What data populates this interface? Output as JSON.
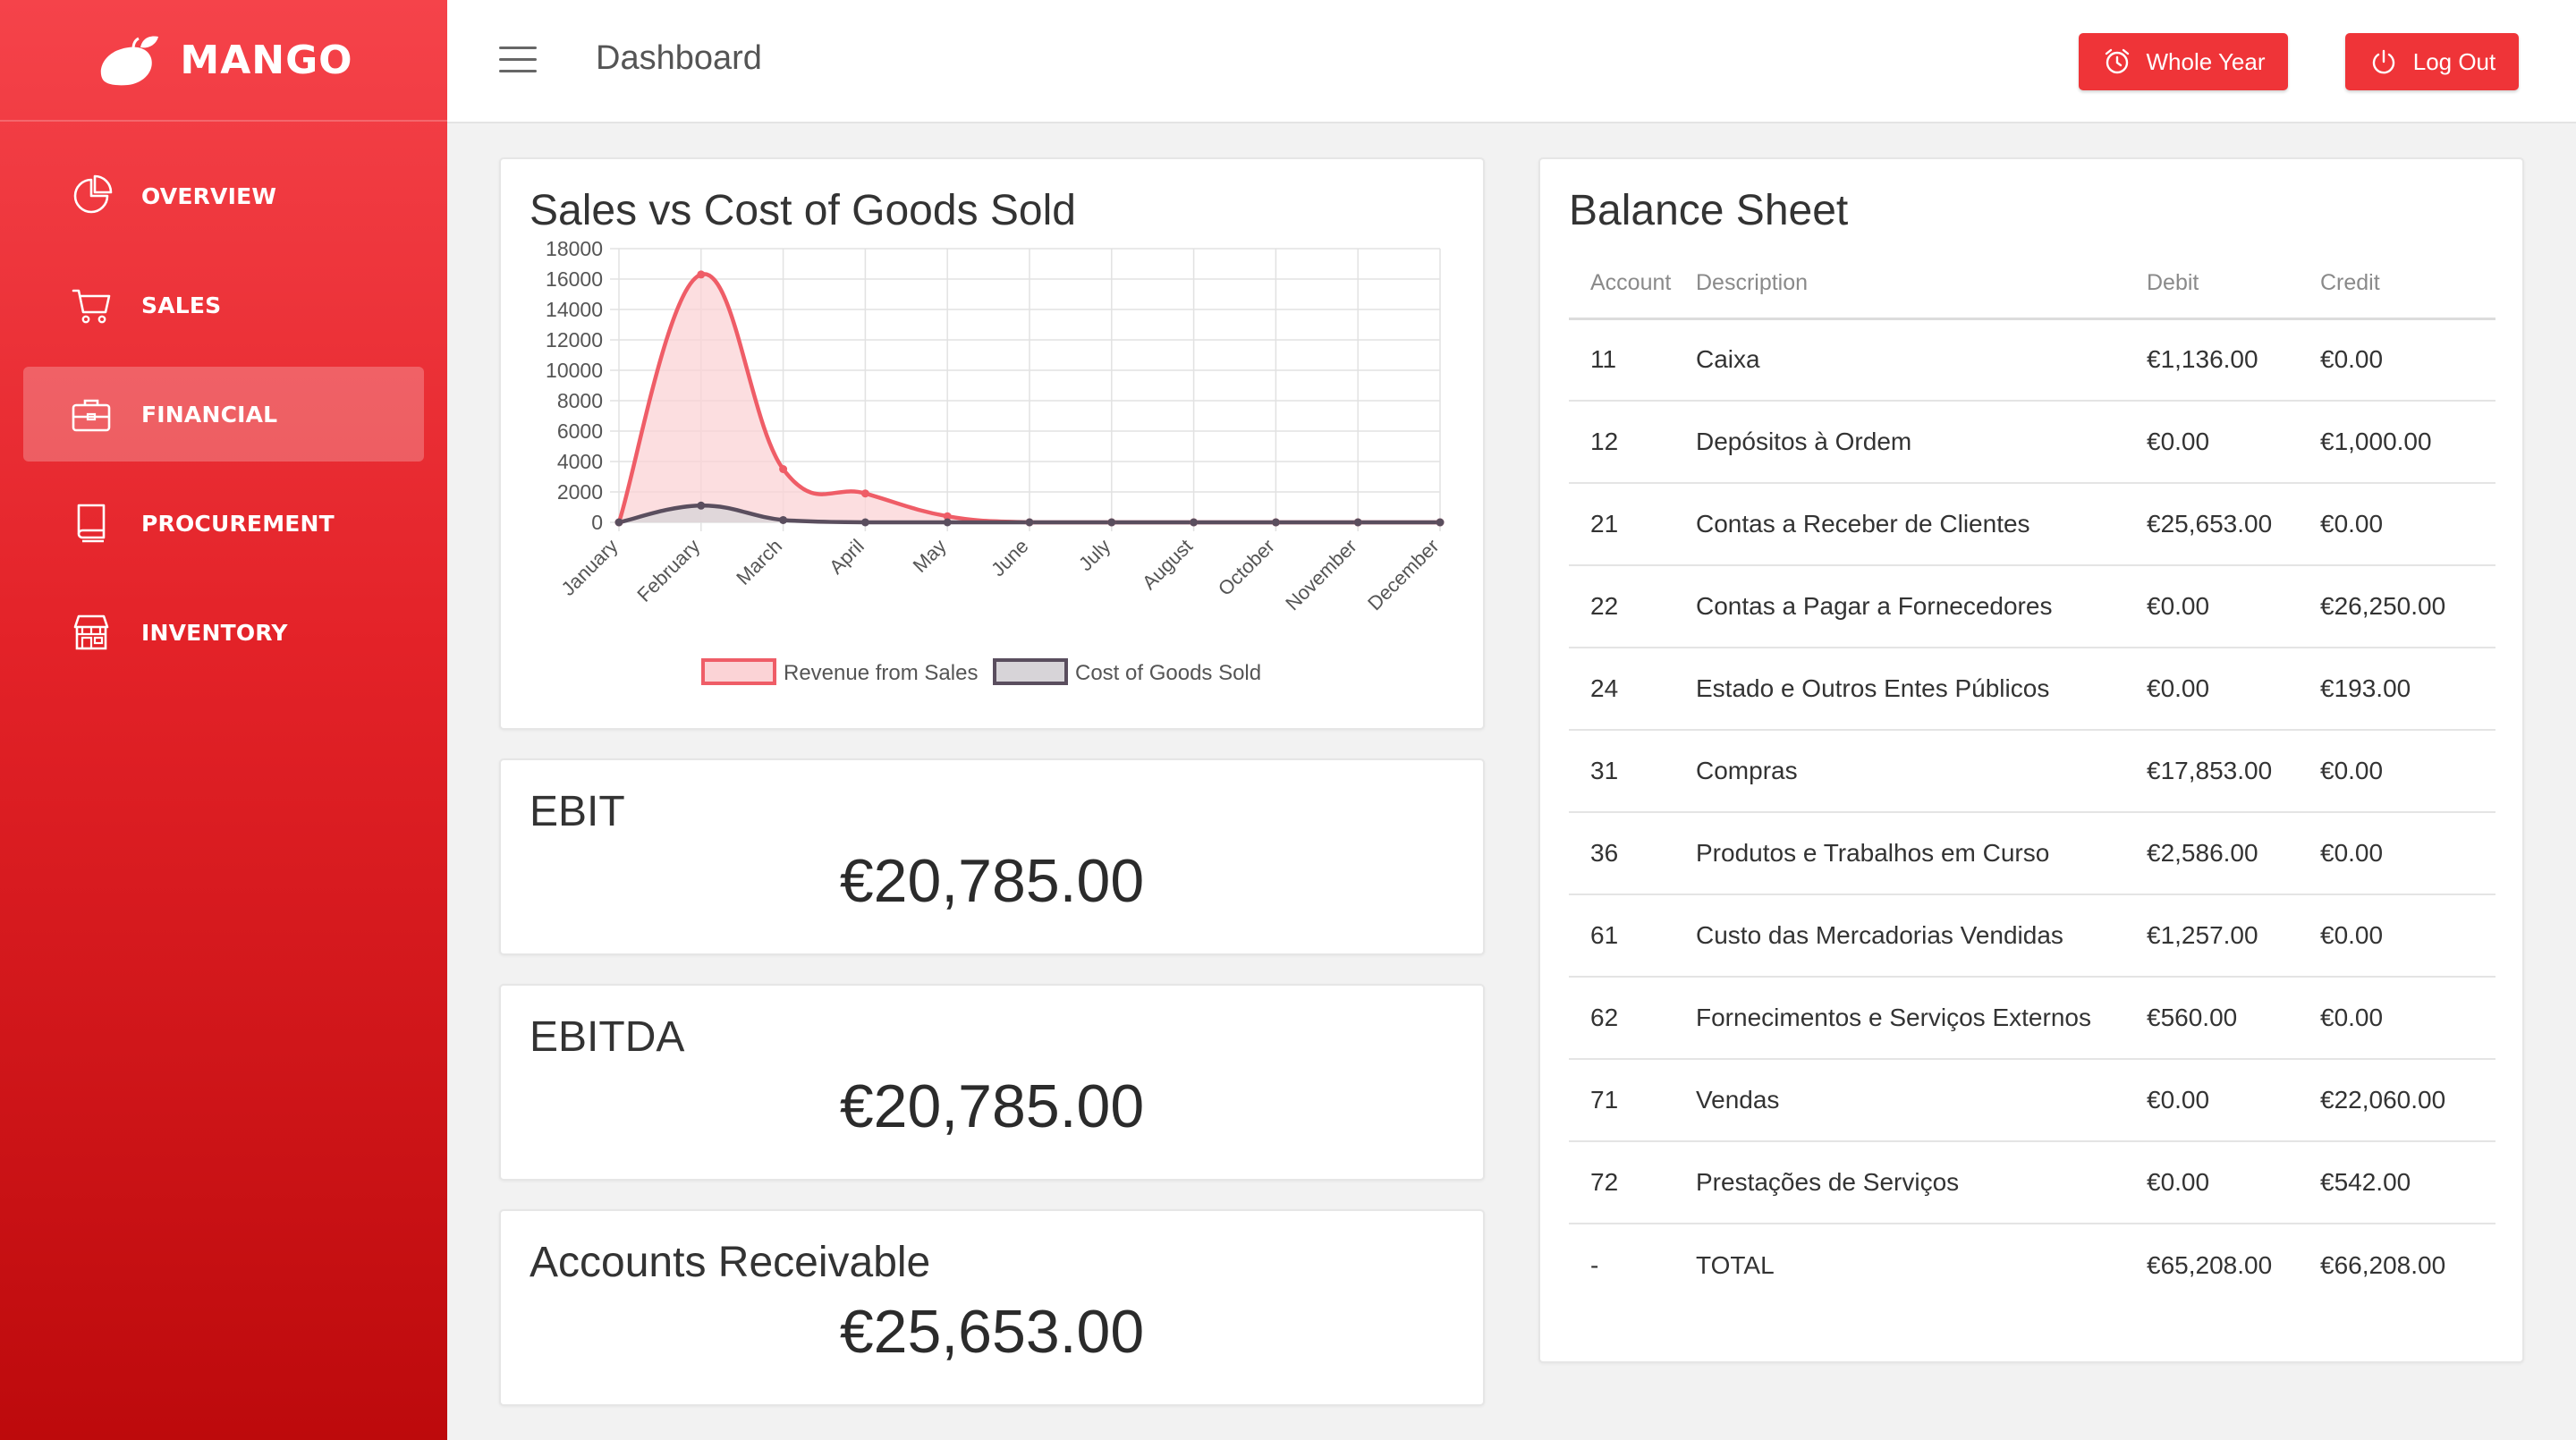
{
  "brand": {
    "name": "MANGO"
  },
  "sidebar": {
    "items": [
      {
        "label": "OVERVIEW",
        "icon": "pie-chart-icon",
        "active": false
      },
      {
        "label": "SALES",
        "icon": "cart-icon",
        "active": false
      },
      {
        "label": "FINANCIAL",
        "icon": "briefcase-icon",
        "active": true
      },
      {
        "label": "PROCUREMENT",
        "icon": "book-icon",
        "active": false
      },
      {
        "label": "INVENTORY",
        "icon": "store-icon",
        "active": false
      }
    ]
  },
  "header": {
    "title": "Dashboard",
    "period_button": "Whole Year",
    "logout_button": "Log Out"
  },
  "colors": {
    "accent": "#ef3438",
    "revenue_line": "#ef5d67",
    "revenue_fill": "#fbd3d6",
    "cogs_line": "#5a4e5e",
    "cogs_fill": "#d7d4d8"
  },
  "chart_data": {
    "type": "area",
    "title": "Sales vs Cost of Goods Sold",
    "categories": [
      "January",
      "February",
      "March",
      "April",
      "May",
      "June",
      "July",
      "August",
      "October",
      "November",
      "December"
    ],
    "series": [
      {
        "name": "Revenue from Sales",
        "values": [
          0,
          16300,
          3500,
          1900,
          400,
          0,
          0,
          0,
          0,
          0,
          0
        ]
      },
      {
        "name": "Cost of Goods Sold",
        "values": [
          0,
          1100,
          150,
          0,
          0,
          0,
          0,
          0,
          0,
          0,
          0
        ]
      }
    ],
    "yticks": [
      0,
      2000,
      4000,
      6000,
      8000,
      10000,
      12000,
      14000,
      16000,
      18000
    ],
    "ylim": [
      0,
      18000
    ],
    "grid": true,
    "legend": "bottom"
  },
  "kpis": {
    "ebit": {
      "label": "EBIT",
      "value": "€20,785.00"
    },
    "ebitda": {
      "label": "EBITDA",
      "value": "€20,785.00"
    },
    "accounts_receivable": {
      "label": "Accounts Receivable",
      "value": "€25,653.00"
    }
  },
  "balance_sheet": {
    "title": "Balance Sheet",
    "headers": [
      "Account",
      "Description",
      "Debit",
      "Credit"
    ],
    "rows": [
      [
        "11",
        "Caixa",
        "€1,136.00",
        "€0.00"
      ],
      [
        "12",
        "Depósitos à Ordem",
        "€0.00",
        "€1,000.00"
      ],
      [
        "21",
        "Contas a Receber de Clientes",
        "€25,653.00",
        "€0.00"
      ],
      [
        "22",
        "Contas a Pagar a Fornecedores",
        "€0.00",
        "€26,250.00"
      ],
      [
        "24",
        "Estado e Outros Entes Públicos",
        "€0.00",
        "€193.00"
      ],
      [
        "31",
        "Compras",
        "€17,853.00",
        "€0.00"
      ],
      [
        "36",
        "Produtos e Trabalhos em Curso",
        "€2,586.00",
        "€0.00"
      ],
      [
        "61",
        "Custo das Mercadorias Vendidas",
        "€1,257.00",
        "€0.00"
      ],
      [
        "62",
        "Fornecimentos e Serviços Externos",
        "€560.00",
        "€0.00"
      ],
      [
        "71",
        "Vendas",
        "€0.00",
        "€22,060.00"
      ],
      [
        "72",
        "Prestações de Serviços",
        "€0.00",
        "€542.00"
      ],
      [
        "-",
        "TOTAL",
        "€65,208.00",
        "€66,208.00"
      ]
    ]
  }
}
